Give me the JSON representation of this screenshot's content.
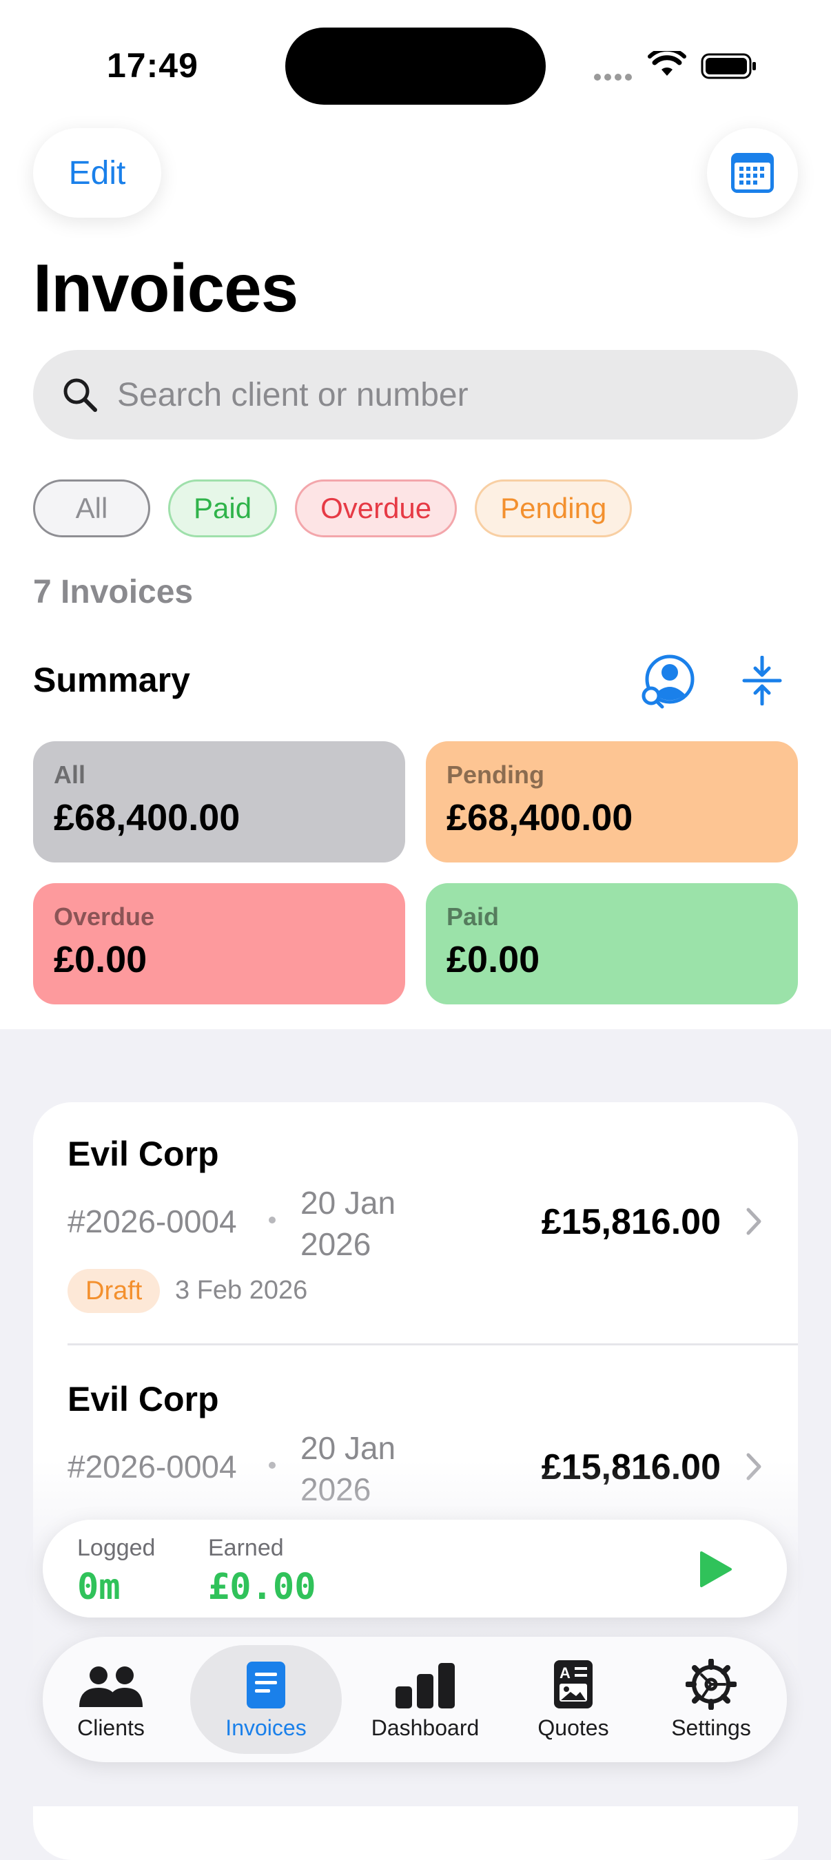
{
  "status_bar": {
    "time": "17:49"
  },
  "header": {
    "edit_label": "Edit",
    "title": "Invoices"
  },
  "search": {
    "placeholder": "Search client or number"
  },
  "filters": [
    {
      "label": "All"
    },
    {
      "label": "Paid"
    },
    {
      "label": "Overdue"
    },
    {
      "label": "Pending"
    }
  ],
  "invoice_count": "7 Invoices",
  "summary": {
    "title": "Summary",
    "cards": {
      "all": {
        "label": "All",
        "amount": "£68,400.00"
      },
      "pending": {
        "label": "Pending",
        "amount": "£68,400.00"
      },
      "overdue": {
        "label": "Overdue",
        "amount": "£0.00"
      },
      "paid": {
        "label": "Paid",
        "amount": "£0.00"
      }
    }
  },
  "invoices": [
    {
      "client": "Evil Corp",
      "number": "#2026-0004",
      "date": "20 Jan 2026",
      "total": "£15,816.00",
      "status": "Draft",
      "due": "3 Feb 2026"
    },
    {
      "client": "Evil Corp",
      "number": "#2026-0004",
      "date": "20 Jan 2026",
      "total": "£15,816.00"
    }
  ],
  "timer": {
    "logged_label": "Logged",
    "logged_value": "0m",
    "earned_label": "Earned",
    "earned_value": "£0.00"
  },
  "tabs": [
    {
      "label": "Clients",
      "icon": "people-icon"
    },
    {
      "label": "Invoices",
      "icon": "document-icon",
      "active": true
    },
    {
      "label": "Dashboard",
      "icon": "bar-chart-icon"
    },
    {
      "label": "Quotes",
      "icon": "quote-doc-icon"
    },
    {
      "label": "Settings",
      "icon": "gear-icon"
    }
  ],
  "colors": {
    "accent": "#1a80ea",
    "paid": "#2fb34a",
    "overdue": "#e63a45",
    "pending": "#f3902e"
  }
}
